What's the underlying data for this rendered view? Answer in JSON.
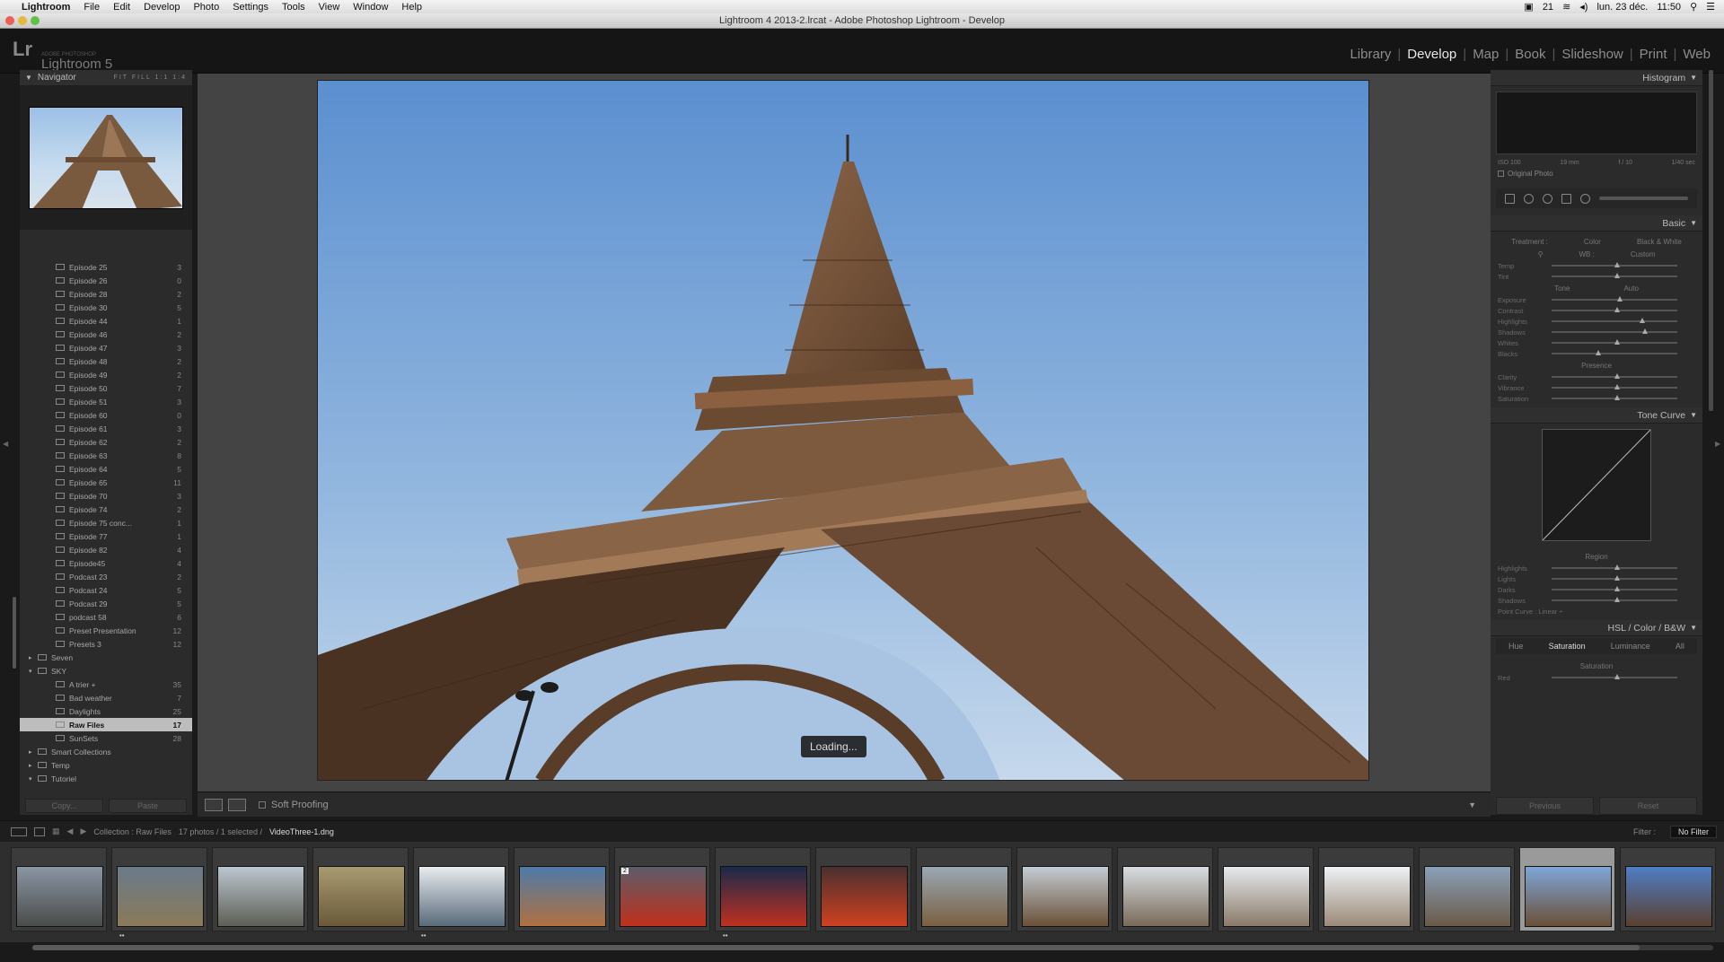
{
  "menubar": {
    "app": "Lightroom",
    "items": [
      "File",
      "Edit",
      "Develop",
      "Photo",
      "Settings",
      "Tools",
      "View",
      "Window",
      "Help"
    ],
    "status_number": "21",
    "datetime": "lun. 23 déc.",
    "time": "11:50"
  },
  "window": {
    "title": "Lightroom 4 2013-2.lrcat - Adobe Photoshop Lightroom - Develop"
  },
  "identity": {
    "logo": "Lr",
    "product": "Lightroom 5"
  },
  "modules": {
    "items": [
      "Library",
      "Develop",
      "Map",
      "Book",
      "Slideshow",
      "Print",
      "Web"
    ],
    "active": "Develop"
  },
  "navigator": {
    "title": "Navigator",
    "zooms": "FIT  FILL  1:1  1:4"
  },
  "collections": [
    {
      "label": "Episode 25",
      "count": "3",
      "level": 2
    },
    {
      "label": "Episode 26",
      "count": "0",
      "level": 2
    },
    {
      "label": "Episode 28",
      "count": "2",
      "level": 2
    },
    {
      "label": "Episode 30",
      "count": "5",
      "level": 2
    },
    {
      "label": "Episode 44",
      "count": "1",
      "level": 2
    },
    {
      "label": "Episode 46",
      "count": "2",
      "level": 2
    },
    {
      "label": "Episode 47",
      "count": "3",
      "level": 2
    },
    {
      "label": "Episode 48",
      "count": "2",
      "level": 2
    },
    {
      "label": "Episode 49",
      "count": "2",
      "level": 2
    },
    {
      "label": "Episode 50",
      "count": "7",
      "level": 2
    },
    {
      "label": "Episode 51",
      "count": "3",
      "level": 2
    },
    {
      "label": "Episode 60",
      "count": "0",
      "level": 2
    },
    {
      "label": "Episode 61",
      "count": "3",
      "level": 2
    },
    {
      "label": "Episode 62",
      "count": "2",
      "level": 2
    },
    {
      "label": "Episode 63",
      "count": "8",
      "level": 2
    },
    {
      "label": "Episode 64",
      "count": "5",
      "level": 2
    },
    {
      "label": "Episode 65",
      "count": "11",
      "level": 2
    },
    {
      "label": "Episode 70",
      "count": "3",
      "level": 2
    },
    {
      "label": "Episode 74",
      "count": "2",
      "level": 2
    },
    {
      "label": "Episode 75 conc...",
      "count": "1",
      "level": 2
    },
    {
      "label": "Episode 77",
      "count": "1",
      "level": 2
    },
    {
      "label": "Episode 82",
      "count": "4",
      "level": 2
    },
    {
      "label": "Episode45",
      "count": "4",
      "level": 2
    },
    {
      "label": "Podcast 23",
      "count": "2",
      "level": 2
    },
    {
      "label": "Podcast 24",
      "count": "5",
      "level": 2
    },
    {
      "label": "Podcast 29",
      "count": "5",
      "level": 2
    },
    {
      "label": "podcast 58",
      "count": "6",
      "level": 2
    },
    {
      "label": "Preset Presentation",
      "count": "12",
      "level": 2
    },
    {
      "label": "Presets 3",
      "count": "12",
      "level": 2
    },
    {
      "label": "Seven",
      "count": "",
      "level": 1,
      "arrow": "▸"
    },
    {
      "label": "SKY",
      "count": "",
      "level": 1,
      "arrow": "▾"
    },
    {
      "label": "A trier +",
      "count": "35",
      "level": 2
    },
    {
      "label": "Bad weather",
      "count": "7",
      "level": 2
    },
    {
      "label": "Daylights",
      "count": "25",
      "level": 2
    },
    {
      "label": "Raw Files",
      "count": "17",
      "level": 2,
      "selected": true
    },
    {
      "label": "SunSets",
      "count": "28",
      "level": 2
    },
    {
      "label": "Smart Collections",
      "count": "",
      "level": 1,
      "arrow": "▸"
    },
    {
      "label": "Temp",
      "count": "",
      "level": 1,
      "arrow": "▸"
    },
    {
      "label": "Tutoriel",
      "count": "",
      "level": 1,
      "arrow": "▾"
    }
  ],
  "left_buttons": {
    "import": "Copy...",
    "export": "Paste"
  },
  "center": {
    "loading": "Loading..."
  },
  "toolbar": {
    "soft_proofing": "Soft Proofing"
  },
  "right": {
    "histogram": "Histogram",
    "histo_info": [
      "ISO 100",
      "19 mm",
      "f / 10",
      "1/40 sec"
    ],
    "original_photo": "Original Photo",
    "basic": "Basic",
    "treatment": "Treatment :",
    "color": "Color",
    "bw": "Black & White",
    "wb": "WB :",
    "custom": "Custom",
    "temp": "Temp",
    "tint": "Tint",
    "tone": "Tone",
    "auto": "Auto",
    "exposure": "Exposure",
    "contrast": "Contrast",
    "highlights": "Highlights",
    "shadows": "Shadows",
    "whites": "Whites",
    "blacks": "Blacks",
    "presence": "Presence",
    "clarity": "Clarity",
    "vibrance": "Vibrance",
    "saturation": "Saturation",
    "tone_curve": "Tone Curve",
    "region": "Region",
    "highlights_c": "Highlights",
    "lights": "Lights",
    "darks": "Darks",
    "shadows_c": "Shadows",
    "point_curve": "Point Curve : Linear ÷",
    "hsl_header": "HSL / Color / B&W",
    "hsl_tabs": [
      "Hue",
      "Saturation",
      "Luminance",
      "All"
    ],
    "hsl_active": "Saturation",
    "sat_label": "Saturation",
    "red": "Red",
    "previous": "Previous",
    "reset": "Reset"
  },
  "filmbar": {
    "collection": "Collection : Raw Files",
    "count": "17 photos / 1 selected /",
    "filename": "VideoThree-1.dng",
    "filter_label": "Filter :",
    "filter": "No Filter"
  },
  "thumbs": [
    {
      "top": "#8a96a4",
      "bottom": "#4a4c4a",
      "badge": "",
      "dots": ""
    },
    {
      "top": "#6b7a8a",
      "bottom": "#8a7a5a",
      "badge": "",
      "dots": "••"
    },
    {
      "top": "#bcc6cf",
      "bottom": "#5d5f55",
      "badge": "",
      "dots": ""
    },
    {
      "top": "#a89a70",
      "bottom": "#6a5a3a",
      "badge": "",
      "dots": ""
    },
    {
      "top": "#e8ecef",
      "bottom": "#5a6a7a",
      "badge": "",
      "dots": "••"
    },
    {
      "top": "#4e7aa8",
      "bottom": "#b07040",
      "badge": "",
      "dots": ""
    },
    {
      "top": "#5c5c6a",
      "bottom": "#c0301a",
      "badge": "2",
      "dots": ""
    },
    {
      "top": "#1a2a4a",
      "bottom": "#c03020",
      "badge": "",
      "dots": "••"
    },
    {
      "top": "#4a3030",
      "bottom": "#d04020",
      "badge": "",
      "dots": ""
    },
    {
      "top": "#9aa8b4",
      "bottom": "#7a6040",
      "badge": "",
      "dots": ""
    },
    {
      "top": "#c4ccd4",
      "bottom": "#6a5038",
      "badge": "",
      "dots": ""
    },
    {
      "top": "#d8dde2",
      "bottom": "#7a6a58",
      "badge": "",
      "dots": ""
    },
    {
      "top": "#e6eaee",
      "bottom": "#8a7a68",
      "badge": "",
      "dots": ""
    },
    {
      "top": "#eef1f4",
      "bottom": "#9a8a78",
      "badge": "",
      "dots": ""
    },
    {
      "top": "#8aa0b8",
      "bottom": "#6a5a48",
      "badge": "",
      "dots": ""
    },
    {
      "top": "#7fa6d8",
      "bottom": "#6a5038",
      "badge": "",
      "dots": "",
      "selected": true
    },
    {
      "top": "#4f7ec4",
      "bottom": "#5a4030",
      "badge": "",
      "dots": ""
    }
  ]
}
